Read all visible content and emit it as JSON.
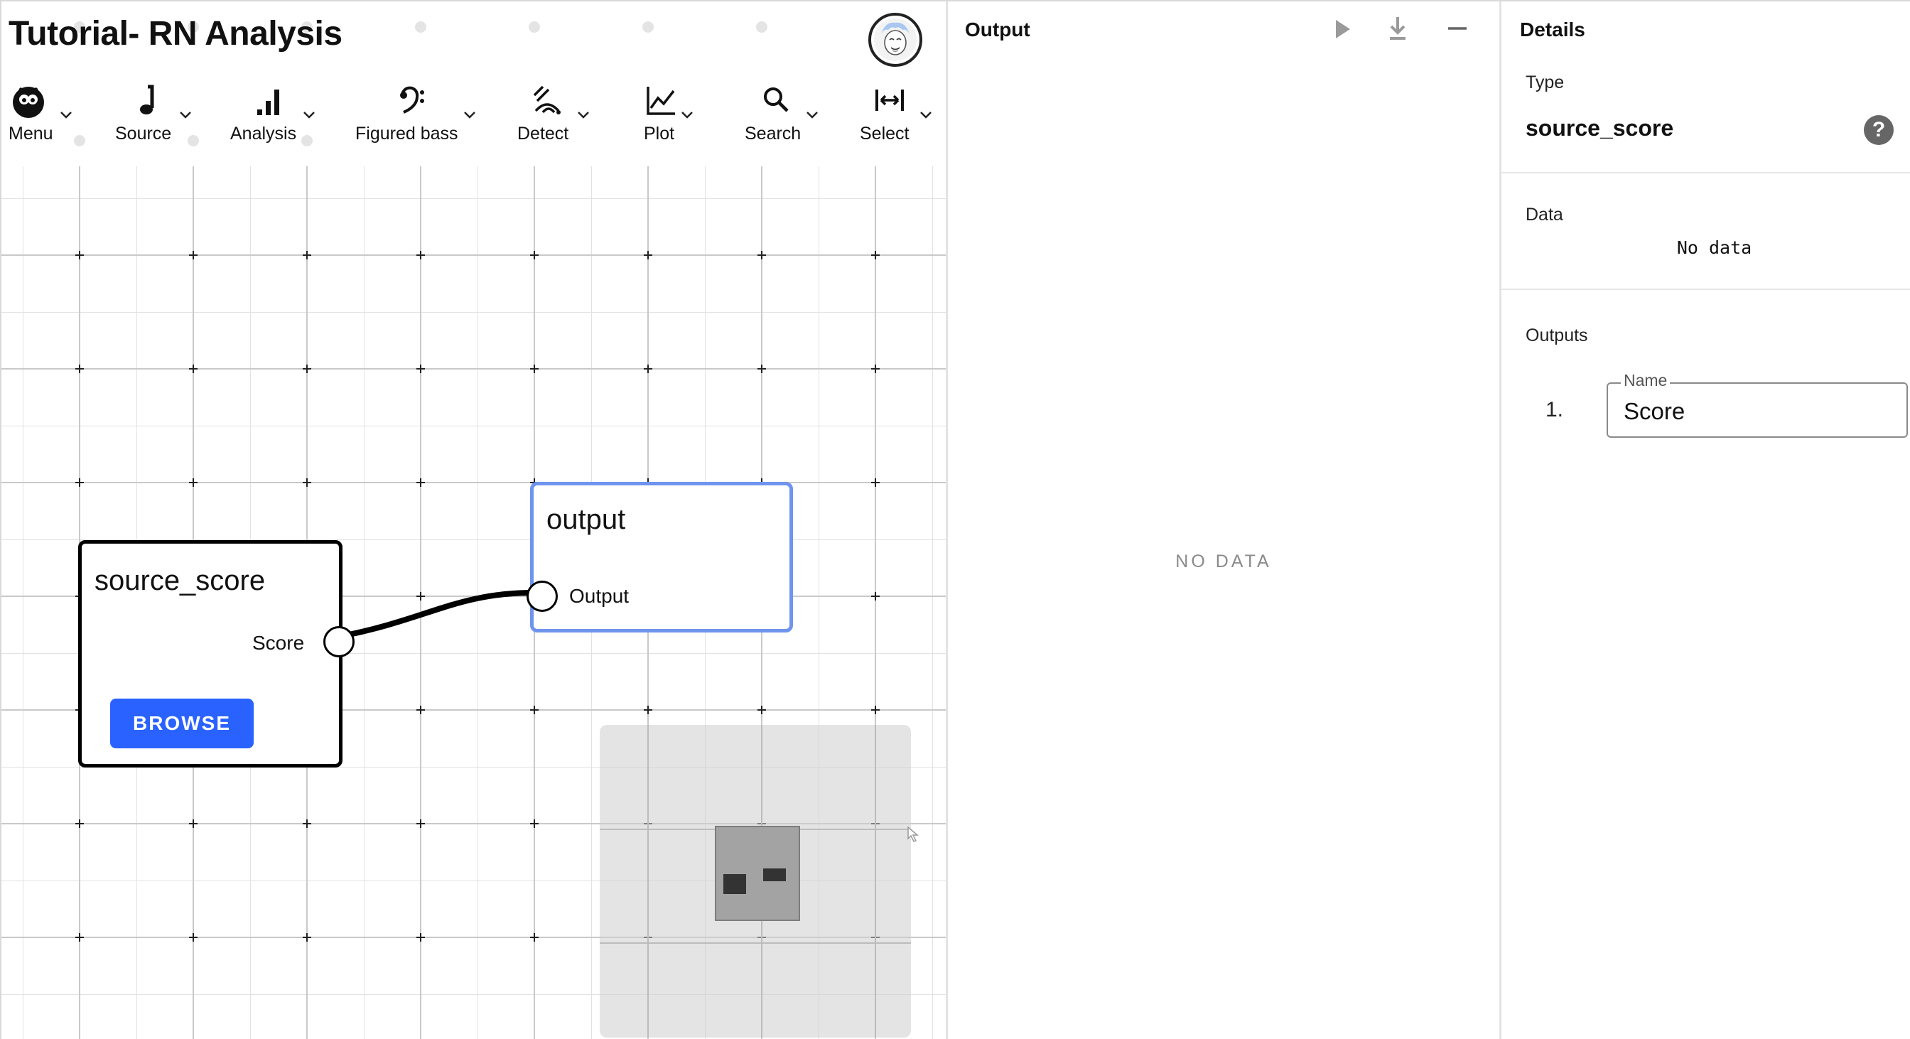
{
  "app": {
    "title": "Tutorial- RN Analysis"
  },
  "toolbar": {
    "items": [
      {
        "label": "Menu",
        "icon": "rnb-logo-icon"
      },
      {
        "label": "Source",
        "icon": "music-note-icon"
      },
      {
        "label": "Analysis",
        "icon": "bar-chart-icon"
      },
      {
        "label": "Figured bass",
        "icon": "bass-clef-icon"
      },
      {
        "label": "Detect",
        "icon": "detect-waves-icon"
      },
      {
        "label": "Plot",
        "icon": "line-chart-icon"
      },
      {
        "label": "Search",
        "icon": "search-icon"
      },
      {
        "label": "Select",
        "icon": "select-range-icon"
      }
    ]
  },
  "canvas": {
    "nodes": {
      "source": {
        "title": "source_score",
        "port_label": "Score",
        "button_label": "BROWSE"
      },
      "output": {
        "title": "output",
        "port_label": "Output"
      }
    }
  },
  "output_panel": {
    "title": "Output",
    "empty_text": "NO DATA",
    "actions": [
      "play-icon",
      "download-icon",
      "minimize-icon"
    ]
  },
  "details_panel": {
    "title": "Details",
    "type_label": "Type",
    "type_value": "source_score",
    "help_glyph": "?",
    "data_label": "Data",
    "data_value": "No data",
    "outputs_label": "Outputs",
    "outputs": [
      {
        "index": "1.",
        "field_label": "Name",
        "value": "Score"
      }
    ]
  },
  "colors": {
    "accent_button": "#2962ff",
    "selected_node_border": "#6f94ee",
    "grid_line": "#d6d6d6",
    "minimap_bg": "#d9d9d9"
  }
}
